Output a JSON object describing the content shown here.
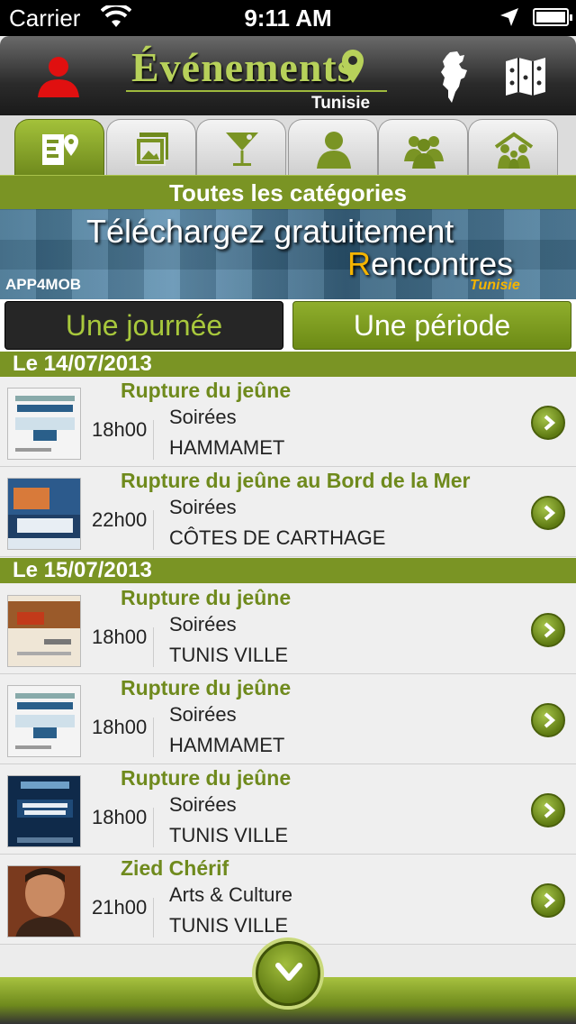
{
  "status_bar": {
    "carrier": "Carrier",
    "time": "9:11 AM"
  },
  "header": {
    "title": "Événements",
    "subtitle": "Tunisie",
    "icons": [
      "user-icon",
      "tunisia-map-icon",
      "map-icon"
    ]
  },
  "tabs": [
    {
      "icon": "events-pin-icon",
      "active": true
    },
    {
      "icon": "gallery-icon",
      "active": false
    },
    {
      "icon": "cocktail-icon",
      "active": false
    },
    {
      "icon": "person-icon",
      "active": false
    },
    {
      "icon": "group-icon",
      "active": false
    },
    {
      "icon": "family-icon",
      "active": false
    }
  ],
  "category_bar": {
    "label": "Toutes les catégories"
  },
  "banner": {
    "headline": "Téléchargez gratuitement",
    "brand_first": "R",
    "brand_rest": "encontres",
    "brand_sub": "Tunisie",
    "app_label": "APP4MOB"
  },
  "segment": {
    "day_label": "Une journée",
    "period_label": "Une période",
    "selected": "Une journée"
  },
  "sections": [
    {
      "date": "Le 14/07/2013",
      "events": [
        {
          "title": "Rupture du jeûne",
          "time": "18h00",
          "category": "Soirées",
          "place": "HAMMAMET"
        },
        {
          "title": "Rupture du jeûne au Bord de la Mer",
          "time": "22h00",
          "category": "Soirées",
          "place": "CÔTES DE CARTHAGE"
        }
      ]
    },
    {
      "date": "Le 15/07/2013",
      "events": [
        {
          "title": "Rupture du jeûne",
          "time": "18h00",
          "category": "Soirées",
          "place": "TUNIS VILLE"
        },
        {
          "title": "Rupture du jeûne",
          "time": "18h00",
          "category": "Soirées",
          "place": "HAMMAMET"
        },
        {
          "title": "Rupture du jeûne",
          "time": "18h00",
          "category": "Soirées",
          "place": "TUNIS VILLE"
        },
        {
          "title": "Zied Chérif",
          "time": "21h00",
          "category": "Arts & Culture",
          "place": "TUNIS VILLE"
        }
      ]
    }
  ],
  "colors": {
    "accent": "#7a9424",
    "title_green": "#6f8a1d",
    "header_dark": "#2b2b2b"
  }
}
